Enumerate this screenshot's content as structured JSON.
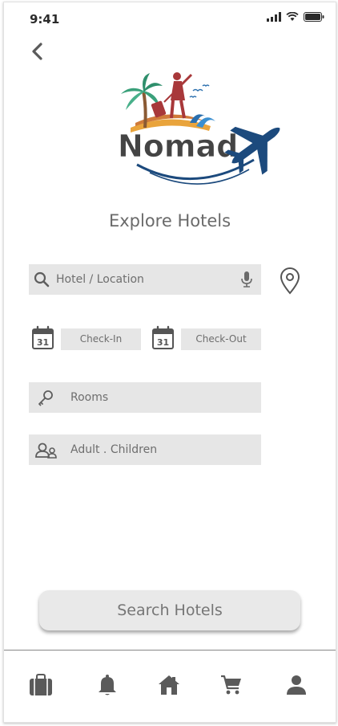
{
  "status_bar": {
    "time": "9:41"
  },
  "header": {
    "title": "Explore Hotels"
  },
  "logo": {
    "brand_text": "Nomad"
  },
  "search": {
    "hotel_placeholder": "Hotel / Location"
  },
  "dates": {
    "check_in": "Check-In",
    "check_out": "Check-Out",
    "calendar_day": "31"
  },
  "rooms": {
    "label": "Rooms"
  },
  "guests": {
    "label": "Adult . Children"
  },
  "actions": {
    "search_label": "Search Hotels"
  },
  "tabs": [
    {
      "icon": "briefcase-icon"
    },
    {
      "icon": "bell-icon"
    },
    {
      "icon": "home-icon"
    },
    {
      "icon": "cart-icon"
    },
    {
      "icon": "user-icon"
    }
  ],
  "colors": {
    "field_bg": "#e6e6e6",
    "brand_navy": "#1c4a7d",
    "text_gray": "#6e6e6e"
  }
}
